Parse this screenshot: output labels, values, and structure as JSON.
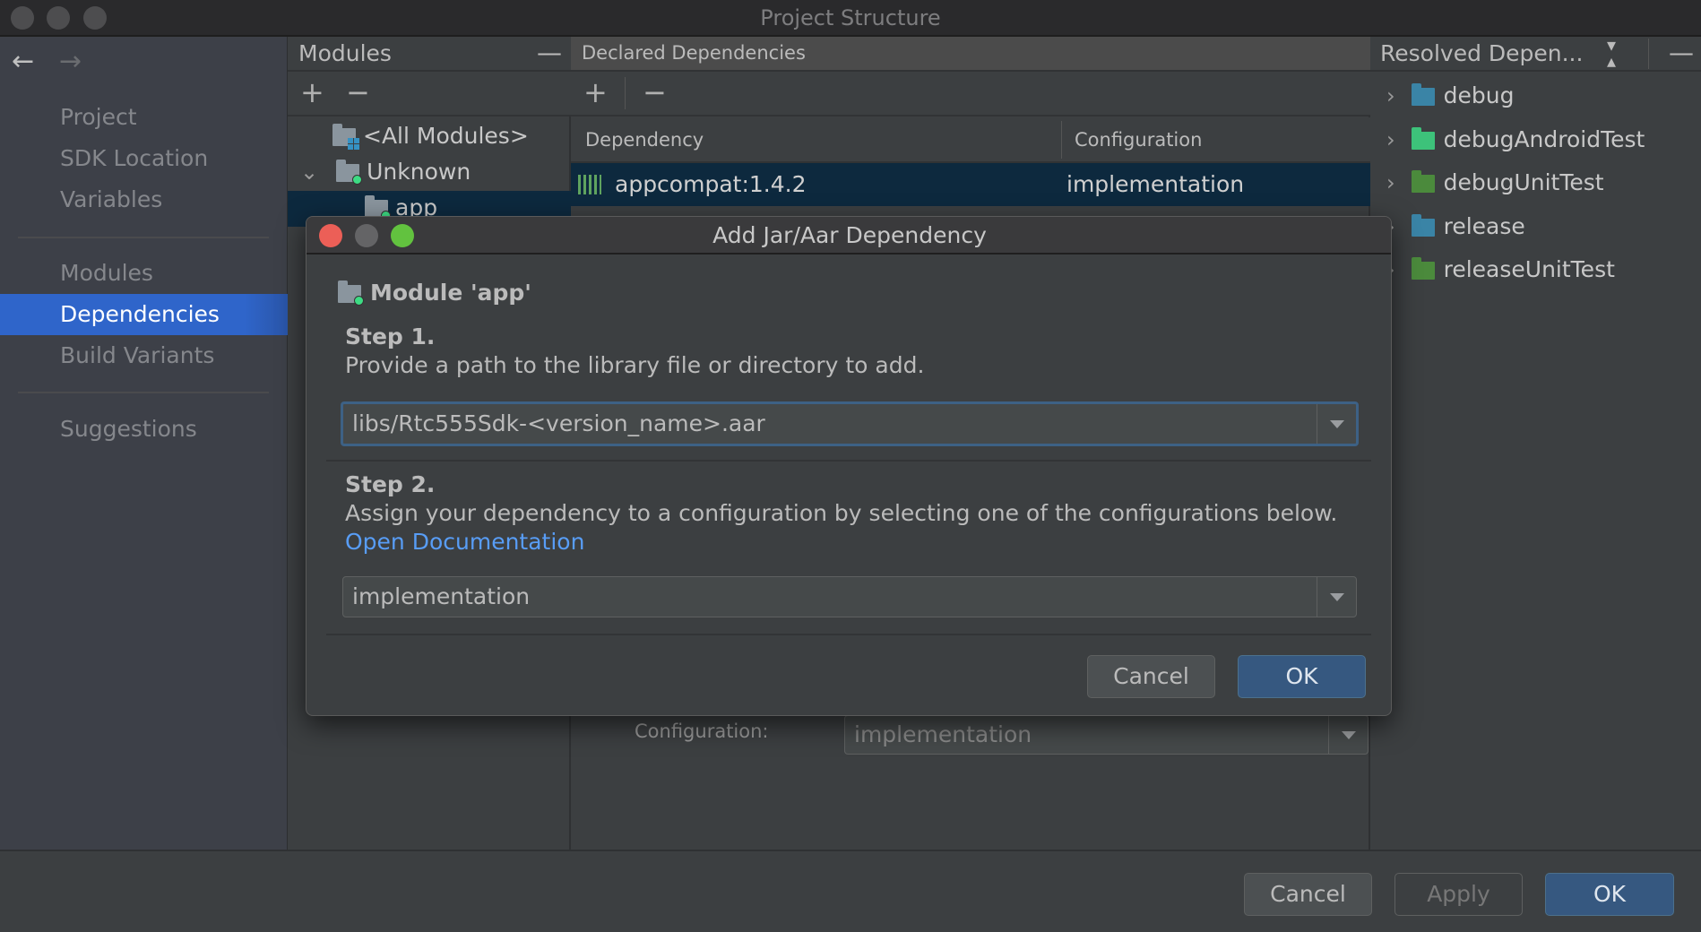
{
  "window": {
    "title": "Project Structure"
  },
  "nav": {
    "back": "←",
    "forward": "→"
  },
  "sidebar": {
    "items": [
      {
        "label": "Project"
      },
      {
        "label": "SDK Location"
      },
      {
        "label": "Variables"
      },
      {
        "label": "Modules"
      },
      {
        "label": "Dependencies",
        "selected": true
      },
      {
        "label": "Build Variants"
      },
      {
        "label": "Suggestions"
      }
    ]
  },
  "modules": {
    "title": "Modules",
    "add": "+",
    "remove": "−",
    "tree": [
      {
        "label": "<All Modules>"
      },
      {
        "label": "Unknown",
        "expanded": true
      },
      {
        "label": "app",
        "selected": true
      }
    ]
  },
  "declared": {
    "title": "Declared Dependencies",
    "add": "+",
    "remove": "−",
    "columns": [
      "Dependency",
      "Configuration"
    ],
    "rows": [
      {
        "dependency": "appcompat:1.4.2",
        "configuration": "implementation"
      }
    ],
    "config_label": "Configuration:",
    "config_value": "implementation"
  },
  "resolved": {
    "title": "Resolved Depen...",
    "items": [
      {
        "label": "debug",
        "color": "#3a84a6"
      },
      {
        "label": "debugAndroidTest",
        "color": "#3dc27a"
      },
      {
        "label": "debugUnitTest",
        "color": "#4b8a3c"
      },
      {
        "label": "release",
        "color": "#3a84a6"
      },
      {
        "label": "releaseUnitTest",
        "color": "#4b8a3c"
      }
    ]
  },
  "footer": {
    "cancel": "Cancel",
    "apply": "Apply",
    "ok": "OK"
  },
  "dialog": {
    "title": "Add Jar/Aar Dependency",
    "module": "Module 'app'",
    "step1_title": "Step 1.",
    "step1_desc": "Provide a path to the library file or directory to add.",
    "path_value": "libs/Rtc555Sdk-<version_name>.aar",
    "step2_title": "Step 2.",
    "step2_desc": "Assign your dependency to a configuration by selecting one of the configurations below.",
    "doc_link": "Open Documentation",
    "config_value": "implementation",
    "cancel": "Cancel",
    "ok": "OK"
  },
  "colors": {
    "accent": "#2f65ca",
    "link": "#589df6",
    "primary_button": "#365880",
    "selection": "#0d293e"
  }
}
